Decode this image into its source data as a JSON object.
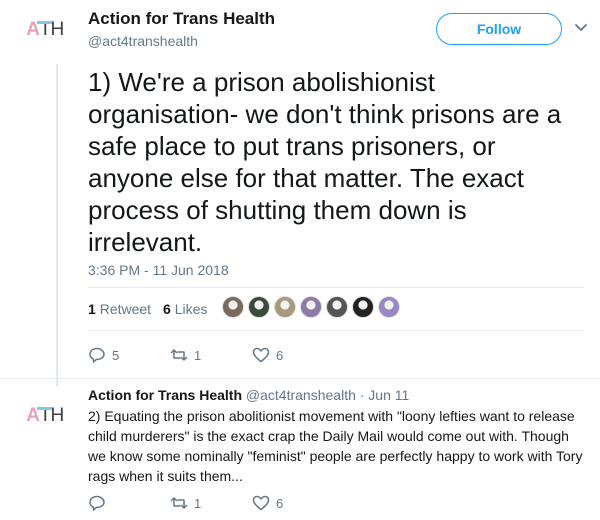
{
  "tweet": {
    "author_name": "Action for Trans Health",
    "handle": "@act4transhealth",
    "follow_label": "Follow",
    "text": "1) We're a prison abolishionist organisation- we don't think prisons are a safe place to put trans prisoners, or anyone else for that matter. The exact process of shutting them down is irrelevant.",
    "timestamp": "3:36 PM - 11 Jun 2018",
    "retweet_count": "1",
    "retweet_label": "Retweet",
    "like_count": "6",
    "like_label": "Likes",
    "replies": "5",
    "retweets": "1",
    "likes": "6"
  },
  "reply": {
    "author_name": "Action for Trans Health",
    "handle_time": "@act4transhealth · Jun 11",
    "text": "2) Equating the prison abolitionist movement with \"loony lefties want to release child murderers\" is the exact crap the Daily Mail would come out with. Though we know some nominally \"feminist\" people are perfectly happy to work with Tory rags when it suits them...",
    "retweets": "1",
    "likes": "6"
  },
  "logo": {
    "a": "A",
    "t": "T",
    "h": "H"
  },
  "colors": {
    "accent": "#1da1f2",
    "muted": "#657786",
    "logo_pink": "#e8a2b8",
    "logo_blue": "#7fc8e8"
  },
  "liker_colors": [
    "#7a6a5c",
    "#3b4a3c",
    "#a89a7a",
    "#8e7aa6",
    "#555555",
    "#222222",
    "#9a86c2"
  ]
}
